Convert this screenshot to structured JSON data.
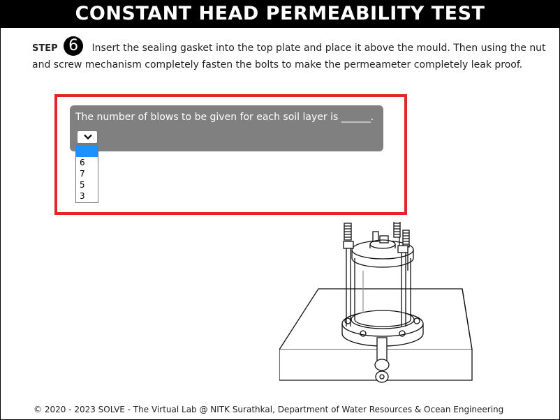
{
  "header": {
    "title": "CONSTANT HEAD PERMEABILITY TEST"
  },
  "step": {
    "label": "STEP",
    "number": "6",
    "instruction": "Insert the sealing gasket into the top plate and place it above the mould. Then using the nut and screw mechanism completely fasten the bolts to make the permeameter completely leak proof."
  },
  "quiz": {
    "question": "The number of blows to be given for each soil layer is ______.",
    "select": {
      "selected": "",
      "options": [
        "",
        "6",
        "7",
        "5",
        "3"
      ],
      "highlighted_index": 0
    },
    "accent_color": "#e3242b",
    "card_color": "#808080"
  },
  "illustration": {
    "icon": "permeameter-apparatus-drawing"
  },
  "footer": {
    "text": "© 2020 - 2023 SOLVE - The Virtual Lab @ NITK Surathkal, Department of Water Resources & Ocean Engineering"
  }
}
